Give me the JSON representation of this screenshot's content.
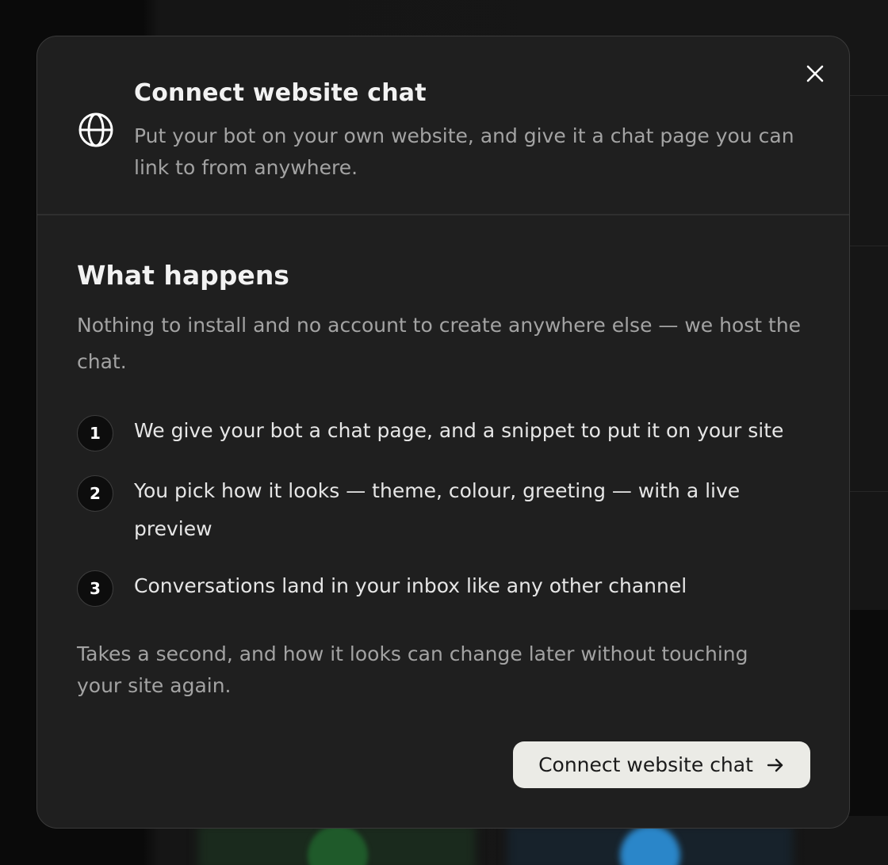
{
  "modal": {
    "title": "Connect website chat",
    "subtitle": "Put your bot on your own website, and give it a chat page you can link to from anywhere.",
    "header_icon": "globe-icon",
    "close_icon": "close-icon"
  },
  "section": {
    "title": "What happens",
    "intro": "Nothing to install and no account to create anywhere else — we host the chat.",
    "steps": [
      {
        "number": "1",
        "text": "We give your bot a chat page, and a snippet to put it on your site"
      },
      {
        "number": "2",
        "text": "You pick how it looks — theme, colour, greeting — with a live preview"
      },
      {
        "number": "3",
        "text": "Conversations land in your inbox like any other channel"
      }
    ],
    "footnote": "Takes a second, and how it looks can change later without touching your site again."
  },
  "cta": {
    "label": "Connect website chat",
    "icon": "arrow-right-icon"
  },
  "colors": {
    "modal_bg": "#1f1f1f",
    "cta_bg": "#ebebe6",
    "text_primary": "#f2f2f2",
    "text_secondary": "#a3a3a3"
  }
}
